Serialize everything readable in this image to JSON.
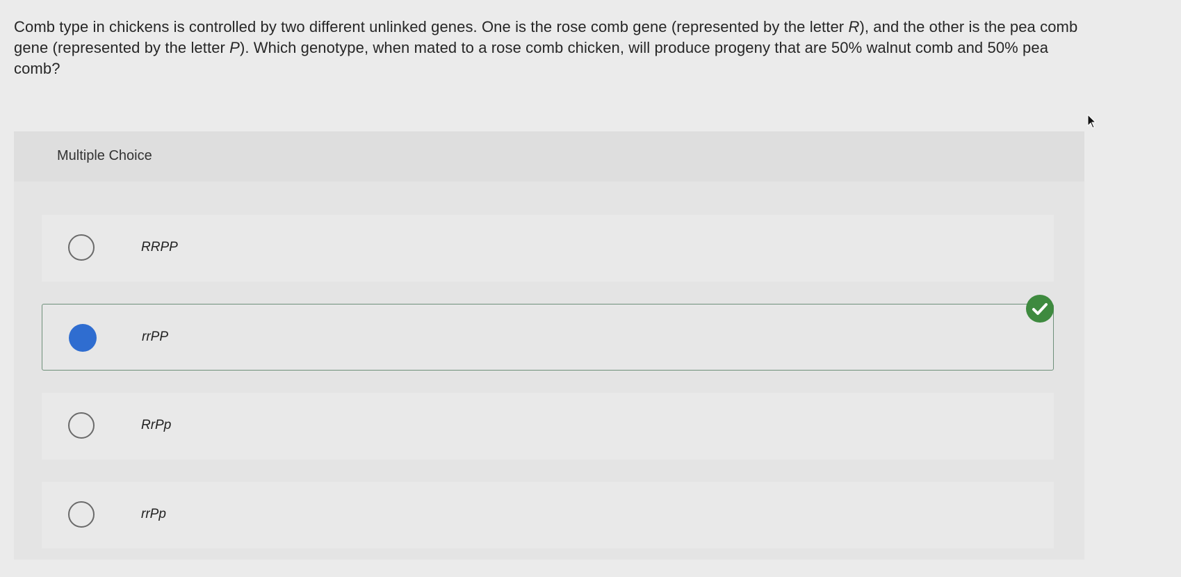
{
  "question": {
    "seg1": "Comb type in chickens is controlled by two different unlinked genes. One is the rose comb gene (represented by the letter ",
    "letter_r": "R",
    "seg2": "), and the other is the pea comb gene (represented by the letter ",
    "letter_p": "P",
    "seg3": "). Which genotype, when mated to a rose comb chicken, will produce progeny that are 50% walnut comb and 50% pea comb?"
  },
  "multiple_choice": {
    "title": "Multiple Choice",
    "options": [
      {
        "label": "RRPP",
        "selected": false
      },
      {
        "label": "rrPP",
        "selected": true,
        "correct": true
      },
      {
        "label": "RrPp",
        "selected": false
      },
      {
        "label": "rrPp",
        "selected": false
      }
    ]
  },
  "icons": {
    "correct": "check-circle-icon",
    "cursor": "mouse-pointer-icon"
  },
  "colors": {
    "selected_radio": "#2f6dd0",
    "correct_badge": "#3e8a3f",
    "selected_border": "#6d8f79"
  }
}
